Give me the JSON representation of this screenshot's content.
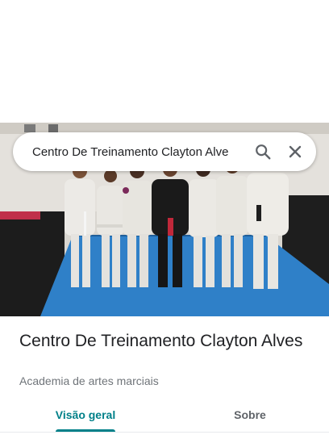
{
  "search": {
    "query": "Centro De Treinamento Clayton Alve"
  },
  "place": {
    "name": "Centro De Treinamento Clayton Alves",
    "category": "Academia de artes marciais"
  },
  "tabs": [
    {
      "label": "Visão geral",
      "active": true
    },
    {
      "label": "Sobre",
      "active": false
    }
  ],
  "colors": {
    "accent": "#008089",
    "mat_blue": "#2f80c8"
  },
  "icons": {
    "search": "search-icon",
    "close": "close-icon"
  }
}
